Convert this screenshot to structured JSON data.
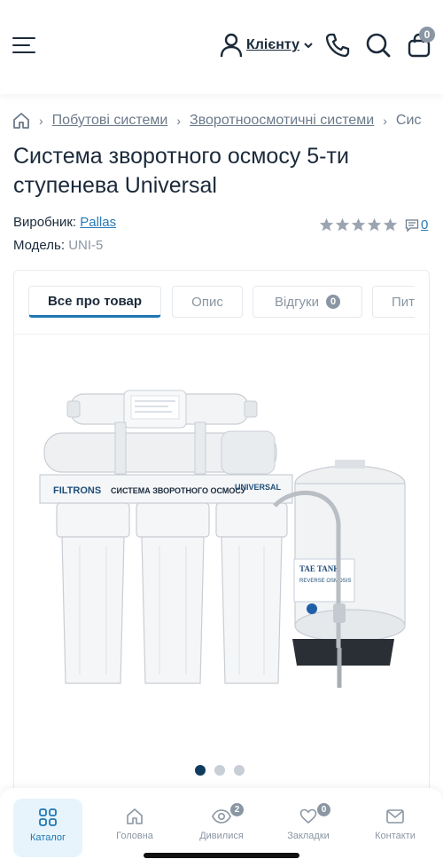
{
  "header": {
    "client_label": "Клієнту",
    "cart_count": "0"
  },
  "breadcrumb": {
    "items": [
      "Побутові системи",
      "Зворотноосмотичні системи",
      "Сис"
    ]
  },
  "product": {
    "title": "Система зворотного осмосу 5-ти ступенева Universal",
    "manufacturer_label": "Виробник:",
    "manufacturer_value": "Pallas",
    "model_label": "Модель:",
    "model_value": "UNI-5",
    "rating": 0,
    "reviews_count": "0",
    "image": {
      "brand": "FILTRONS",
      "caption": "СИСТЕМА ЗВОРОТНОГО ОСМОСУ",
      "series": "UNIVERSAL",
      "tank_label": "TAE TANK",
      "tank_sublabel": "REVERSE OSMOSIS"
    }
  },
  "tabs": [
    {
      "label": "Все про товар",
      "active": true
    },
    {
      "label": "Опис"
    },
    {
      "label": "Відгуки",
      "badge": "0"
    },
    {
      "label": "Пит"
    }
  ],
  "gallery": {
    "total": 3,
    "active": 1
  },
  "bottom_nav": {
    "items": [
      {
        "label": "Каталог",
        "icon": "grid-icon",
        "active": true
      },
      {
        "label": "Головна",
        "icon": "home-icon"
      },
      {
        "label": "Дивилися",
        "icon": "eye-icon",
        "badge": "2"
      },
      {
        "label": "Закладки",
        "icon": "heart-icon",
        "badge": "0"
      },
      {
        "label": "Контакти",
        "icon": "mail-icon"
      }
    ]
  },
  "colors": {
    "text": "#1b2a3a",
    "link": "#2a7bb8",
    "accent": "#1f77b4",
    "muted": "#8a96a3",
    "active_dot": "#0f3b5f"
  }
}
